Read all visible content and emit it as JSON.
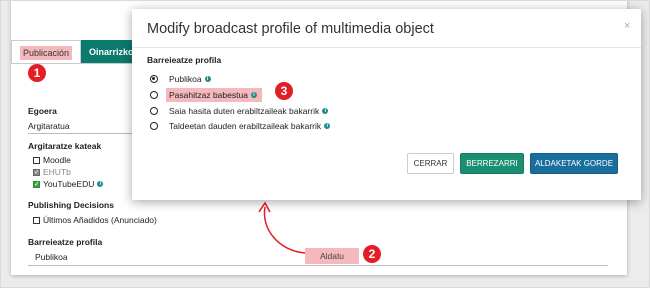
{
  "background": {
    "tabs": [
      {
        "label": "Publicación"
      },
      {
        "label": "Oinarrizko Met"
      }
    ],
    "fields": {
      "egoera_label": "Egoera",
      "egoera_value": "Argitaratua",
      "argitaratze_label": "Argitaratze kateak",
      "channels": [
        {
          "label": "Moodle",
          "state": "unchecked"
        },
        {
          "label": "EHUTb",
          "state": "checked-disabled"
        },
        {
          "label": "YouTubeEDU",
          "state": "checked"
        }
      ],
      "publishing_label": "Publishing Decisions",
      "publishing_option": "Últimos Añadidos (Anunciado)",
      "profile_label": "Barreieatze profila",
      "profile_value": "Publikoa"
    },
    "aldatu_label": "Aldatu"
  },
  "modal": {
    "title": "Modify broadcast profile of multimedia object",
    "close_glyph": "×",
    "section_label": "Barreieatze profila",
    "options": [
      {
        "label": "Publikoa",
        "checked": true
      },
      {
        "label": "Pasahitzaz babestua",
        "checked": false
      },
      {
        "label": "Saia hasita duten erabiltzaileak bakarrik",
        "checked": false
      },
      {
        "label": "Taldeetan dauden erabiltzaileak bakarrik",
        "checked": false
      }
    ],
    "buttons": {
      "cancel": "CERRAR",
      "reset": "BERREZARRI",
      "save": "ALDAKETAK GORDE"
    }
  },
  "annotations": {
    "badge1": "1",
    "badge2": "2",
    "badge3": "3"
  },
  "colors": {
    "highlight": "#f5b8bd",
    "teal_tab": "#0b7a6f",
    "badge": "#e41e26",
    "info": "#1b8e8a"
  }
}
